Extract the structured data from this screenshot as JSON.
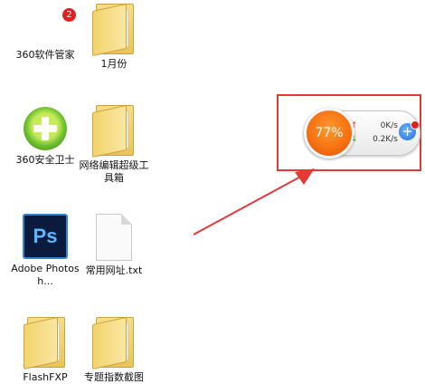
{
  "desktop": {
    "icons": [
      {
        "label": "360软件管家",
        "icon": "360-software-manager-icon",
        "badge": "2"
      },
      {
        "label": "1月份",
        "icon": "folder-icon"
      },
      {
        "label": "360安全卫士",
        "icon": "360-security-guard-icon"
      },
      {
        "label": "网络编辑超级工具箱",
        "icon": "folder-icon"
      },
      {
        "label": "Adobe Photosh...",
        "icon": "photoshop-icon",
        "glyph_text": "Ps"
      },
      {
        "label": "常用网址.txt",
        "icon": "text-file-icon"
      },
      {
        "label": "FlashFXP",
        "icon": "folder-icon"
      },
      {
        "label": "专题指数截图",
        "icon": "folder-icon"
      }
    ]
  },
  "speed_widget": {
    "percent": "77%",
    "upload": "0K/s",
    "download": "0.2K/s",
    "upload_arrow": "↑",
    "download_arrow": "↓",
    "accelerate_symbol": "+"
  },
  "colors": {
    "highlight": "#e53935",
    "ball": "#f2680c",
    "accelerate": "#1d6fd6"
  }
}
